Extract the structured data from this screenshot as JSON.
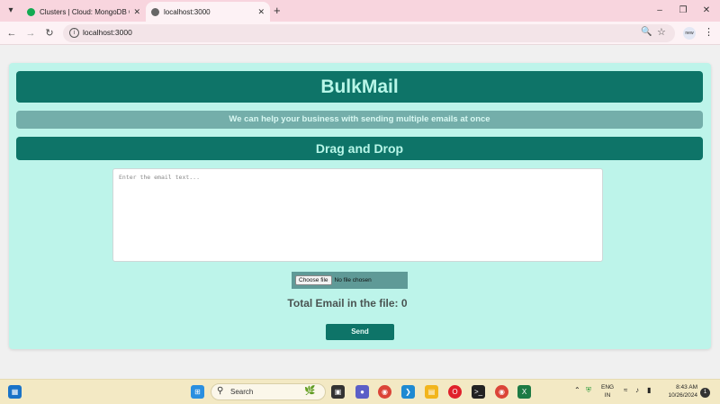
{
  "browser": {
    "tabs": [
      {
        "title": "Clusters | Cloud: MongoDB Cloud",
        "favicon_color": "#13aa52",
        "active": false
      },
      {
        "title": "localhost:3000",
        "favicon_color": "#555555",
        "active": true
      }
    ],
    "url": "localhost:3000",
    "profile_label": "new"
  },
  "app": {
    "title": "BulkMail",
    "subtitle": "We can help your business with sending multiple emails at once",
    "section_title": "Drag and Drop",
    "email_placeholder": "Enter the email text...",
    "email_value": "",
    "file_button_label": "Choose file",
    "file_status": "No file chosen",
    "total_label": "Total Email in the file: 0",
    "send_label": "Send"
  },
  "colors": {
    "accent": "#0e7468",
    "card_bg": "#bdf4ea",
    "header_text": "#b8f6e8"
  },
  "taskbar": {
    "search_text": "Search",
    "language": [
      "ENG",
      "IN"
    ],
    "time": "8:43 AM",
    "date": "10/26/2024",
    "notification_count": "1"
  }
}
